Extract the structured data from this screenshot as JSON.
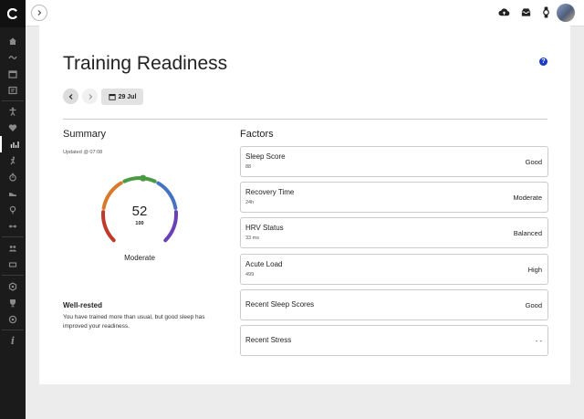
{
  "sidebar": {
    "items": [
      {
        "icon": "home-icon"
      },
      {
        "icon": "activity-wave-icon"
      },
      {
        "icon": "calendar-icon"
      },
      {
        "icon": "report-icon"
      },
      {
        "icon": "training-person-icon"
      },
      {
        "icon": "heart-icon"
      },
      {
        "icon": "chart-bars-icon"
      },
      {
        "icon": "runner-icon"
      },
      {
        "icon": "stopwatch-icon"
      },
      {
        "icon": "shoe-icon"
      },
      {
        "icon": "lightbulb-icon"
      },
      {
        "icon": "connections-icon"
      },
      {
        "icon": "groups-icon"
      },
      {
        "icon": "badges-icon"
      },
      {
        "icon": "trophy-icon"
      },
      {
        "icon": "target-icon"
      },
      {
        "icon": "info-icon"
      }
    ],
    "info_label": "i"
  },
  "header": {
    "icons": [
      "expand-icon",
      "upload-icon",
      "inbox-icon",
      "watch-icon",
      "avatar"
    ]
  },
  "page": {
    "title": "Training Readiness",
    "help_label": "?",
    "date": "29 Jul"
  },
  "summary": {
    "heading": "Summary",
    "updated": "Updated @ 07:08",
    "score": "52",
    "max": "100",
    "status": "Moderate",
    "score_fraction": 0.52,
    "gauge_colors": [
      "#c0392b",
      "#d9792b",
      "#4a9a44",
      "#4672c6",
      "#6a3fb8"
    ],
    "headline": "Well-rested",
    "description": "You have trained more than usual, but good sleep has improved your readiness."
  },
  "factors": {
    "heading": "Factors",
    "items": [
      {
        "name": "Sleep Score",
        "value": "88",
        "status": "Good"
      },
      {
        "name": "Recovery Time",
        "value": "24h",
        "status": "Moderate"
      },
      {
        "name": "HRV Status",
        "value": "33 ms",
        "status": "Balanced"
      },
      {
        "name": "Acute Load",
        "value": "499",
        "status": "High"
      },
      {
        "name": "Recent Sleep Scores",
        "value": "",
        "status": "Good"
      },
      {
        "name": "Recent Stress",
        "value": "",
        "status": "- -"
      }
    ]
  }
}
